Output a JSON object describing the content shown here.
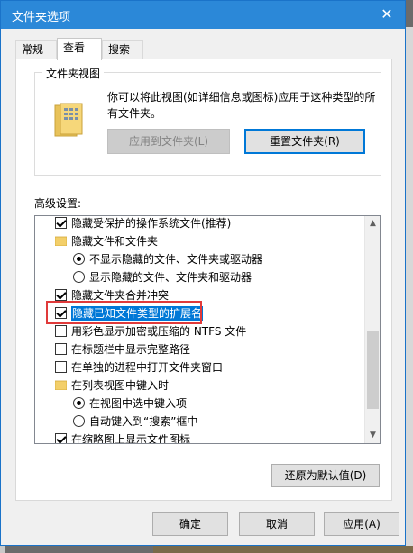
{
  "window": {
    "title": "文件夹选项",
    "close_glyph": "✕"
  },
  "tabs": [
    {
      "label": "常规"
    },
    {
      "label": "查看"
    },
    {
      "label": "搜索"
    }
  ],
  "folder_views": {
    "legend": "文件夹视图",
    "description": "你可以将此视图(如详细信息或图标)应用于这种类型的所有文件夹。",
    "apply_button": "应用到文件夹(L)",
    "reset_button": "重置文件夹(R)"
  },
  "advanced": {
    "label": "高级设置:",
    "items": [
      {
        "type": "checkbox",
        "checked": true,
        "label": "隐藏受保护的操作系统文件(推荐)"
      },
      {
        "type": "folder",
        "label": "隐藏文件和文件夹"
      },
      {
        "type": "radio",
        "checked": true,
        "label": "不显示隐藏的文件、文件夹或驱动器"
      },
      {
        "type": "radio",
        "checked": false,
        "label": "显示隐藏的文件、文件夹和驱动器"
      },
      {
        "type": "checkbox",
        "checked": true,
        "label": "隐藏文件夹合并冲突"
      },
      {
        "type": "checkbox",
        "checked": true,
        "label": "隐藏已知文件类型的扩展名",
        "highlighted": true
      },
      {
        "type": "checkbox",
        "checked": false,
        "label": "用彩色显示加密或压缩的 NTFS 文件"
      },
      {
        "type": "checkbox",
        "checked": false,
        "label": "在标题栏中显示完整路径"
      },
      {
        "type": "checkbox",
        "checked": false,
        "label": "在单独的进程中打开文件夹窗口"
      },
      {
        "type": "folder",
        "label": "在列表视图中键入时"
      },
      {
        "type": "radio",
        "checked": true,
        "label": "在视图中选中键入项"
      },
      {
        "type": "radio",
        "checked": false,
        "label": "自动键入到“搜索”框中"
      },
      {
        "type": "checkbox",
        "checked": true,
        "label": "在缩略图上显示文件图标"
      }
    ],
    "restore_button": "还原为默认值(D)"
  },
  "footer": {
    "ok": "确定",
    "cancel": "取消",
    "apply": "应用(A)"
  },
  "colors": {
    "titlebar": "#2b88d8",
    "selection": "#0078d7",
    "annotation_box": "#e03a3a"
  }
}
